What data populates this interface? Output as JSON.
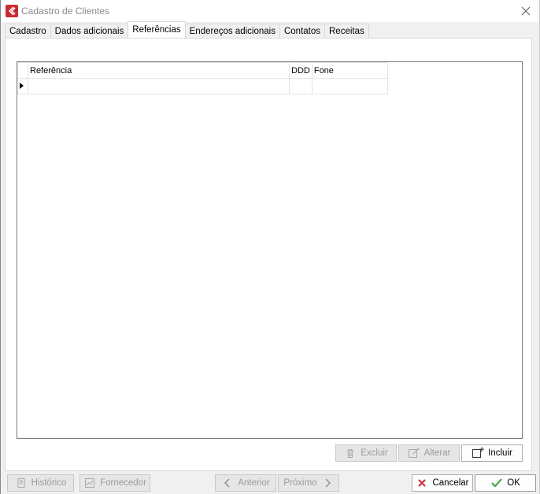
{
  "window": {
    "title": "Cadastro de Clientes"
  },
  "tabs": [
    {
      "label": "Cadastro"
    },
    {
      "label": "Dados adicionais"
    },
    {
      "label": "Referências",
      "active": true
    },
    {
      "label": "Endereços adicionais"
    },
    {
      "label": "Contatos"
    },
    {
      "label": "Receitas"
    }
  ],
  "grid": {
    "columns": [
      "Referência",
      "DDD",
      "Fone"
    ],
    "rows": [
      [
        "",
        "",
        ""
      ]
    ]
  },
  "grid_buttons": {
    "excluir": "Excluir",
    "alterar": "Alterar",
    "incluir": "Incluir"
  },
  "footer": {
    "historico": "Histórico",
    "fornecedor": "Fornecedor",
    "anterior": "Anterior",
    "proximo": "Próximo",
    "cancelar": "Cancelar",
    "ok": "OK"
  },
  "colors": {
    "brand": "#d0282e",
    "ok_check": "#3aa53a",
    "cancel_x": "#d0282e"
  }
}
